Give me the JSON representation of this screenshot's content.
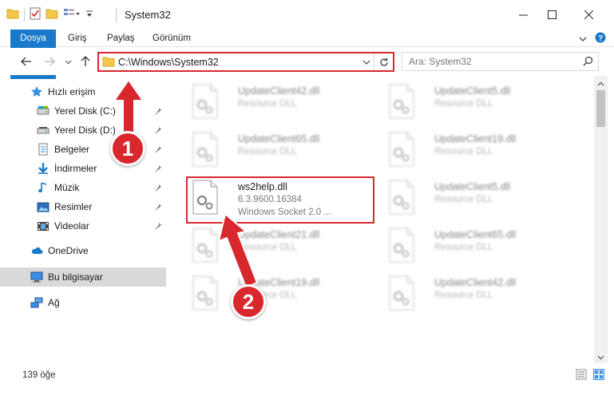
{
  "window": {
    "title": "System32",
    "controls": {
      "minimize": "minimize-icon",
      "maximize": "maximize-icon",
      "close": "close-icon"
    }
  },
  "ribbon": {
    "tabs": [
      {
        "label": "Dosya",
        "active": true
      },
      {
        "label": "Giriş"
      },
      {
        "label": "Paylaş"
      },
      {
        "label": "Görünüm"
      }
    ],
    "accent": "#1979ca"
  },
  "address": {
    "path": "C:\\Windows\\System32",
    "search_placeholder": "Ara: System32"
  },
  "nav": {
    "quick_access": "Hızlı erişim",
    "items": [
      {
        "label": "Yerel Disk (C:)",
        "icon": "drive-icon"
      },
      {
        "label": "Yerel Disk (D:)",
        "icon": "drive-icon"
      },
      {
        "label": "Belgeler",
        "icon": "documents-icon"
      },
      {
        "label": "İndirmeler",
        "icon": "downloads-icon"
      },
      {
        "label": "Müzik",
        "icon": "music-icon"
      },
      {
        "label": "Resimler",
        "icon": "pictures-icon"
      },
      {
        "label": "Videolar",
        "icon": "videos-icon"
      }
    ],
    "onedrive": "OneDrive",
    "this_pc": "Bu bilgisayar",
    "network": "Ağ"
  },
  "files": {
    "left": [
      {
        "name": "UpdateClient42.dll",
        "type": "Resource DLL"
      },
      {
        "name": "UpdateClient65.dll",
        "type": "Resource DLL"
      },
      {
        "name": "ws2help.dll",
        "version": "6.3.9600.16384",
        "desc": "Windows Socket 2.0 ..."
      },
      {
        "name": "UpdateClient21.dll",
        "type": "Resource DLL"
      },
      {
        "name": "UpdateClient19.dll",
        "type": "Resource DLL"
      }
    ],
    "right": [
      {
        "name": "UpdateClient5.dll",
        "type": "Resource DLL"
      },
      {
        "name": "UpdateClient19.dll",
        "type": "Resource DLL"
      },
      {
        "name": "UpdateClient5.dll",
        "type": "Resource DLL"
      },
      {
        "name": "UpdateClient65.dll",
        "type": "Resource DLL"
      },
      {
        "name": "UpdateClient42.dll",
        "type": "Resource DLL"
      }
    ]
  },
  "status": {
    "count": "139 öğe"
  },
  "annotations": {
    "step1": "1",
    "step2": "2",
    "color": "#d9272e"
  }
}
